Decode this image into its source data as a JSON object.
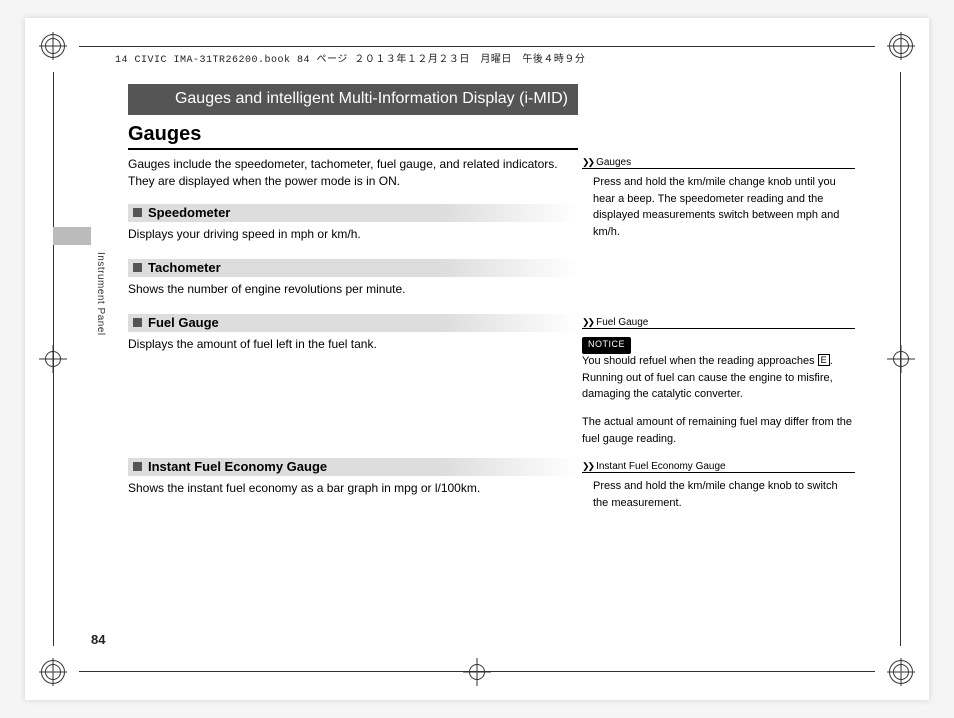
{
  "meta": {
    "crop_header": "14 CIVIC IMA-31TR26200.book  84 ページ  ２０１３年１２月２３日　月曜日　午後４時９分"
  },
  "chapter": {
    "title": "Gauges and intelligent Multi-Information Display (i-MID)"
  },
  "section": {
    "title": "Gauges",
    "intro": "Gauges include the speedometer, tachometer, fuel gauge, and related indicators. They are displayed when the power mode is in ON."
  },
  "subsections": {
    "speedometer": {
      "label": "Speedometer",
      "body": "Displays your driving speed in mph or km/h."
    },
    "tachometer": {
      "label": "Tachometer",
      "body": "Shows the number of engine revolutions per minute."
    },
    "fuel": {
      "label": "Fuel Gauge",
      "body": "Displays the amount of fuel left in the fuel tank."
    },
    "economy": {
      "label": "Instant Fuel Economy Gauge",
      "body": "Shows the instant fuel economy as a bar graph in mpg or l/100km."
    }
  },
  "sidebar": {
    "tab_label": "Instrument Panel"
  },
  "right_col": {
    "gauges": {
      "title": "Gauges",
      "body": "Press and hold the km/mile change knob until you hear a beep. The speedometer reading and the displayed measurements switch between mph and km/h."
    },
    "fuel": {
      "title": "Fuel Gauge",
      "notice": "NOTICE",
      "body1a": "You should refuel when the reading approaches ",
      "e": "E",
      "body1b": ". Running out of fuel can cause the engine to misfire, damaging the catalytic converter.",
      "body2": "The actual amount of remaining fuel may differ from the fuel gauge reading."
    },
    "economy": {
      "title": "Instant Fuel Economy Gauge",
      "body": "Press and hold the km/mile change knob to switch the measurement."
    }
  },
  "page_number": "84"
}
